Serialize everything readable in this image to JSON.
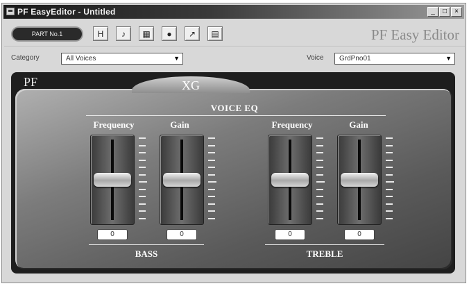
{
  "window": {
    "title": "PF EasyEditor - Untitled"
  },
  "title_buttons": [
    {
      "icon": "minimize-icon",
      "glyph": "_"
    },
    {
      "icon": "maximize-icon",
      "glyph": "□"
    },
    {
      "icon": "close-icon",
      "glyph": "×"
    }
  ],
  "toolbar": {
    "part_label": "PART No.1",
    "tools": [
      {
        "icon": "save-icon",
        "glyph": "H"
      },
      {
        "icon": "note-icon",
        "glyph": "♪"
      },
      {
        "icon": "keyboard-icon",
        "glyph": "▦"
      },
      {
        "icon": "record-icon",
        "glyph": "●"
      },
      {
        "icon": "arrow-icon",
        "glyph": "↗"
      },
      {
        "icon": "list-icon",
        "glyph": "▤"
      }
    ]
  },
  "app_title": "PF Easy Editor",
  "category": {
    "label": "Category",
    "value": "All Voices"
  },
  "voice": {
    "label": "Voice",
    "value": "GrdPno01"
  },
  "tabs": {
    "pf": "PF",
    "xg": "XG"
  },
  "eq": {
    "title": "VOICE EQ",
    "groups": [
      {
        "name": "BASS",
        "bands": [
          {
            "label": "Frequency",
            "value": "0",
            "level": 0.5
          },
          {
            "label": "Gain",
            "value": "0",
            "level": 0.5
          }
        ]
      },
      {
        "name": "TREBLE",
        "bands": [
          {
            "label": "Frequency",
            "value": "0",
            "level": 0.5
          },
          {
            "label": "Gain",
            "value": "0",
            "level": 0.5
          }
        ]
      }
    ]
  }
}
